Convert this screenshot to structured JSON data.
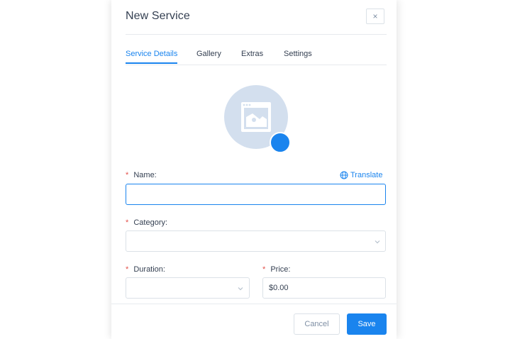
{
  "dialog": {
    "title": "New Service",
    "close_label": "×"
  },
  "tabs": [
    {
      "label": "Service Details",
      "active": true
    },
    {
      "label": "Gallery",
      "active": false
    },
    {
      "label": "Extras",
      "active": false
    },
    {
      "label": "Settings",
      "active": false
    }
  ],
  "form": {
    "required_marker": "*",
    "translate_label": "Translate",
    "name": {
      "label": "Name:",
      "value": ""
    },
    "category": {
      "label": "Category:",
      "value": ""
    },
    "duration": {
      "label": "Duration:",
      "value": ""
    },
    "price": {
      "label": "Price:",
      "value": "$0.00"
    }
  },
  "footer": {
    "cancel_label": "Cancel",
    "save_label": "Save"
  },
  "colors": {
    "accent": "#1a84ee",
    "required": "#e3504a",
    "placeholder_image": "#d3dfee"
  },
  "icons": {
    "close": "close-icon",
    "image_placeholder": "image-placeholder-icon",
    "globe": "globe-icon",
    "chevron": "chevron-down-icon"
  }
}
